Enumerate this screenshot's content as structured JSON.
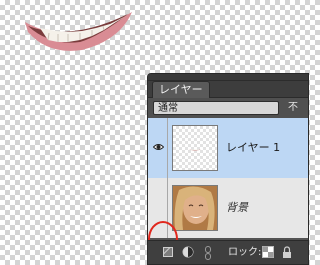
{
  "panel": {
    "tab_label": "レイヤー",
    "blend_mode": "通常",
    "opacity_label": "不"
  },
  "layers": [
    {
      "name": "レイヤー 1",
      "selected": true,
      "visible": true,
      "thumbnail": "mouth-cutout-checker"
    },
    {
      "name": "背景",
      "selected": false,
      "visible": false,
      "thumbnail": "portrait-photo"
    }
  ],
  "bottom_bar": {
    "lock_label": "ロック:",
    "icons": [
      "new-layer-icon",
      "adjustment-layer-icon",
      "link-icon",
      "lock-transparency-icon",
      "lock-all-icon"
    ]
  },
  "annotation": {
    "circle_color": "#e0281e",
    "highlight_color": "#bdd7f4"
  }
}
